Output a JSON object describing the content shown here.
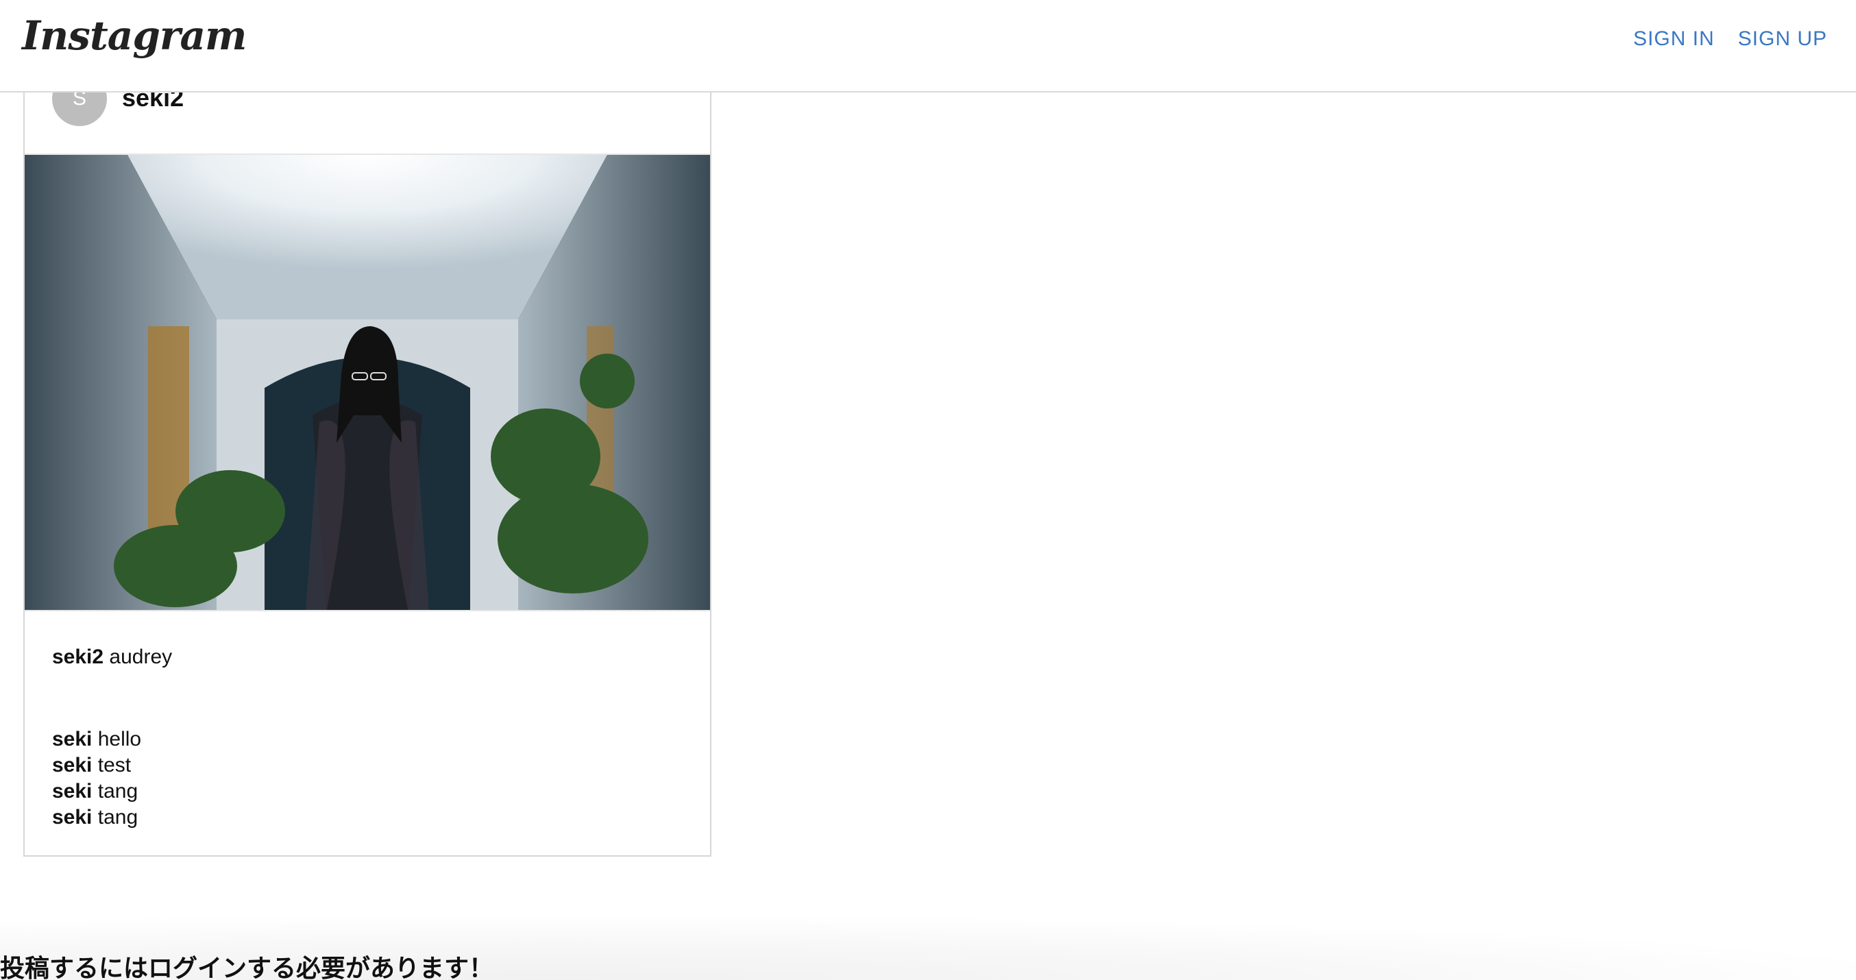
{
  "header": {
    "logo": "Instagram",
    "nav": {
      "sign_in": "SIGN IN",
      "sign_up": "SIGN UP"
    }
  },
  "post": {
    "avatar_initial": "S",
    "username": "seki2",
    "caption": {
      "user": "seki2",
      "text": "audrey"
    },
    "comments": [
      {
        "user": "seki",
        "text": "hello"
      },
      {
        "user": "seki",
        "text": "test"
      },
      {
        "user": "seki",
        "text": "tang"
      },
      {
        "user": "seki",
        "text": "tang"
      }
    ]
  },
  "footer": {
    "login_prompt": "投稿するにはログインする必要があります！"
  },
  "colors": {
    "link": "#3a78c3",
    "border": "#d6d6d6",
    "avatar_bg": "#bdbdbd"
  }
}
